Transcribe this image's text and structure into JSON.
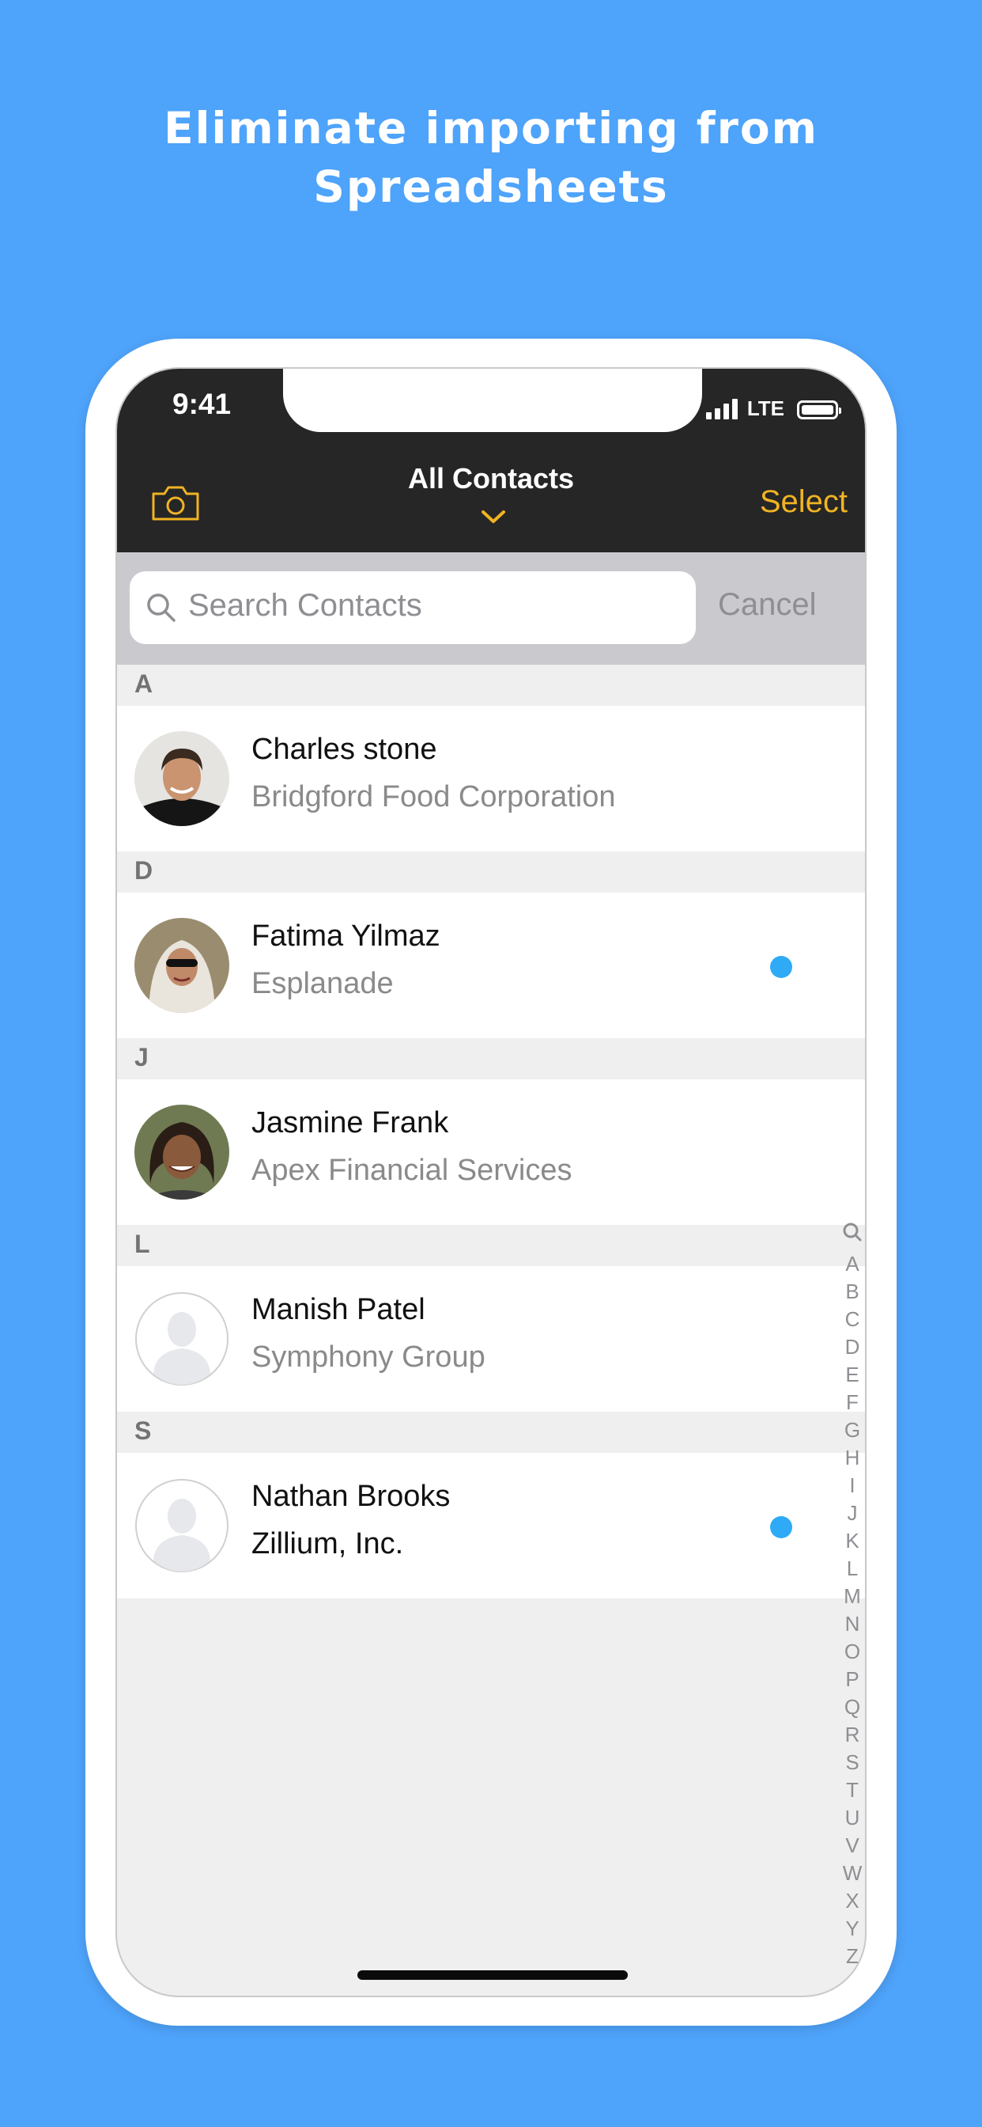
{
  "headline": {
    "line1": "Eliminate importing from",
    "line2": "Spreadsheets"
  },
  "status_bar": {
    "time": "9:41",
    "network": "LTE"
  },
  "nav": {
    "title": "All Contacts",
    "select_label": "Select",
    "left_icon": "camera-icon",
    "title_icon": "chevron-down-icon",
    "accent_color": "#f0b323"
  },
  "search": {
    "placeholder": "Search Contacts",
    "value": "",
    "cancel_label": "Cancel"
  },
  "sections": [
    {
      "letter": "A",
      "contacts": [
        {
          "name": "Charles stone",
          "company": "Bridgford Food Corporation",
          "avatar": "photo-man",
          "unread": false
        }
      ]
    },
    {
      "letter": "D",
      "contacts": [
        {
          "name": "Fatima Yilmaz",
          "company": "Esplanade",
          "avatar": "photo-woman-headscarf",
          "unread": true
        }
      ]
    },
    {
      "letter": "J",
      "contacts": [
        {
          "name": "Jasmine Frank",
          "company": "Apex Financial Services",
          "avatar": "photo-woman",
          "unread": false
        }
      ]
    },
    {
      "letter": "L",
      "contacts": [
        {
          "name": "Manish Patel",
          "company": "Symphony Group",
          "avatar": "placeholder-avatar-icon",
          "unread": false
        }
      ]
    },
    {
      "letter": "S",
      "contacts": [
        {
          "name": "Nathan Brooks",
          "company": "Zillium, Inc.",
          "avatar": "placeholder-avatar-icon",
          "unread": true
        }
      ]
    }
  ],
  "index": [
    "A",
    "B",
    "C",
    "D",
    "E",
    "F",
    "G",
    "H",
    "I",
    "J",
    "K",
    "L",
    "M",
    "N",
    "O",
    "P",
    "Q",
    "R",
    "S",
    "T",
    "U",
    "V",
    "W",
    "X",
    "Y",
    "Z",
    "#"
  ],
  "colors": {
    "background": "#4ea3fa",
    "unread_dot": "#2faaf6",
    "nav_bar": "#262626"
  }
}
